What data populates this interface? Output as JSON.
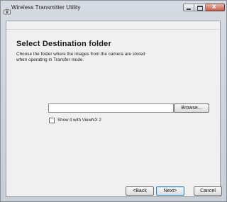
{
  "window": {
    "title": "Wireless Transmitter Utility",
    "icon": "camera-app-icon",
    "controls": {
      "minimize": "minimize-icon",
      "maximize": "maximize-icon",
      "close_glyph": "x"
    }
  },
  "page": {
    "heading": "Select Destination folder",
    "description_line1": "Choose the folder where the images from the camera are stored",
    "description_line2": "when operating in Transfer mode."
  },
  "folder": {
    "value": "",
    "placeholder": "",
    "browse_label": "Browse..."
  },
  "viewnx_option": {
    "label": "Show it with ViewNX 2",
    "checked": false
  },
  "footer": {
    "back_label": "<Back",
    "next_label": "Next>",
    "cancel_label": "Cancel"
  },
  "colors": {
    "close_button": "#c3594a",
    "panel_background": "#f0f0f0"
  }
}
